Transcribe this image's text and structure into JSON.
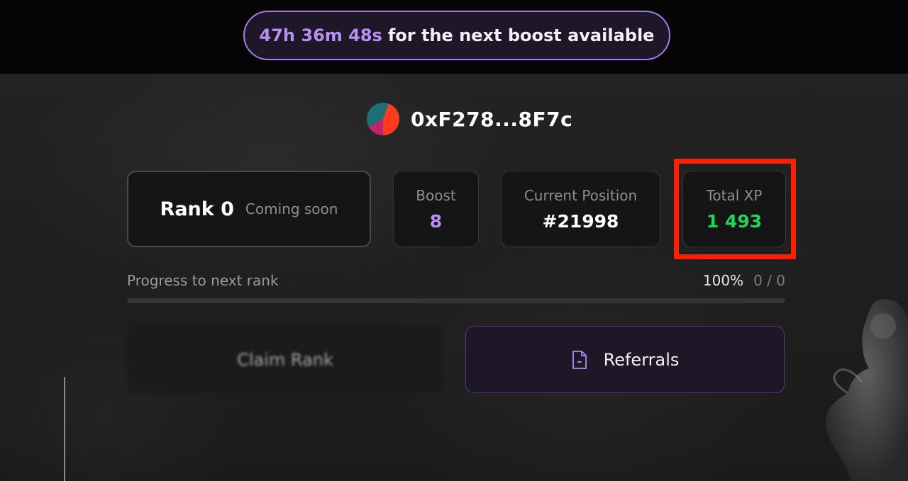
{
  "boost_banner": {
    "countdown": "47h 36m 48s",
    "message": "for the next boost available"
  },
  "wallet": {
    "address": "0xF278...8F7c",
    "avatar_icon": "wallet-avatar-icon"
  },
  "rank": {
    "title": "Rank 0",
    "status": "Coming soon"
  },
  "stats": {
    "boost": {
      "label": "Boost",
      "value": "8"
    },
    "position": {
      "label": "Current Position",
      "value": "#21998"
    },
    "total_xp": {
      "label": "Total XP",
      "value": "1 493"
    }
  },
  "progress": {
    "label": "Progress to next rank",
    "percent_text": "100%",
    "count_text": "0 / 0",
    "fill_fraction": 1.0
  },
  "actions": {
    "claim_label": "Claim Rank",
    "referrals_label": "Referrals",
    "referrals_icon": "document-icon"
  },
  "colors": {
    "accent_purple": "#b88ff3",
    "xp_green": "#22d45a",
    "highlight_red": "#ff1e06"
  }
}
